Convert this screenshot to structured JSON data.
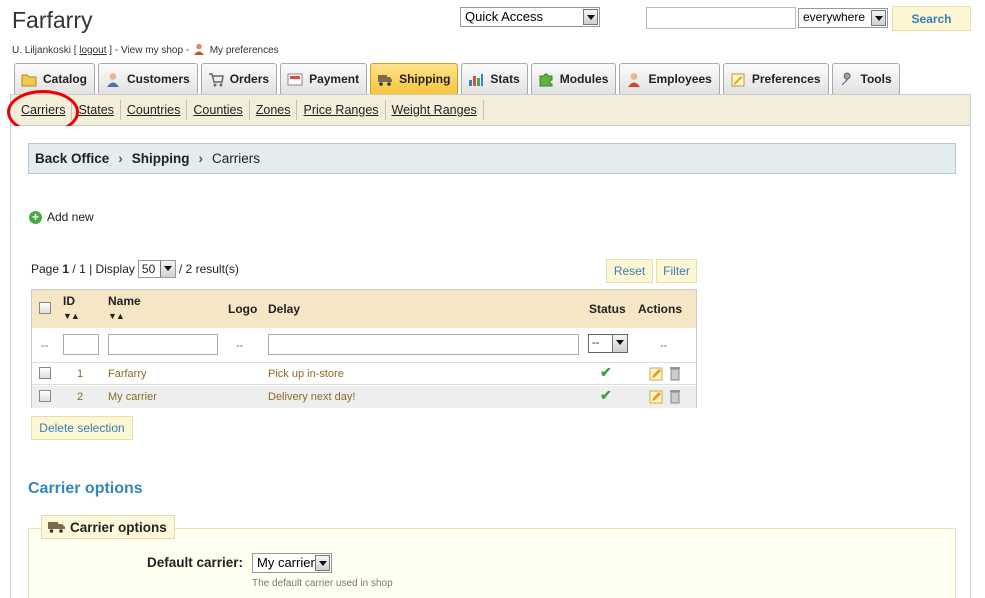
{
  "header": {
    "shop_name": "Farfarry",
    "user_name": "U. Liljankoski",
    "logout_label": "logout",
    "view_shop_label": "View my shop",
    "preferences_label": "My preferences",
    "quick_access_label": "Quick Access",
    "search_value": "",
    "search_scope": "everywhere",
    "search_button_label": "Search"
  },
  "tabs": [
    {
      "label": "Catalog",
      "icon": "folder-icon",
      "active": false
    },
    {
      "label": "Customers",
      "icon": "customer-icon",
      "active": false
    },
    {
      "label": "Orders",
      "icon": "cart-icon",
      "active": false
    },
    {
      "label": "Payment",
      "icon": "payment-icon",
      "active": false
    },
    {
      "label": "Shipping",
      "icon": "truck-icon",
      "active": true
    },
    {
      "label": "Stats",
      "icon": "stats-icon",
      "active": false
    },
    {
      "label": "Modules",
      "icon": "puzzle-icon",
      "active": false
    },
    {
      "label": "Employees",
      "icon": "employee-icon",
      "active": false
    },
    {
      "label": "Preferences",
      "icon": "preferences-icon",
      "active": false
    },
    {
      "label": "Tools",
      "icon": "wrench-icon",
      "active": false
    }
  ],
  "subnav": [
    "Carriers",
    "States",
    "Countries",
    "Counties",
    "Zones",
    "Price Ranges",
    "Weight Ranges"
  ],
  "breadcrumb": {
    "root": "Back Office",
    "section": "Shipping",
    "current": "Carriers"
  },
  "add_new_label": "Add new",
  "pager": {
    "page_label": "Page",
    "page": "1",
    "of": "/ 1 | Display",
    "per_page": "50",
    "results": "/ 2 result(s)"
  },
  "reset_label": "Reset",
  "filter_label": "Filter",
  "table": {
    "columns": {
      "id": "ID",
      "name": "Name",
      "logo": "Logo",
      "delay": "Delay",
      "status": "Status",
      "actions": "Actions"
    },
    "filter_placeholder": "--",
    "status_filter": "--",
    "rows": [
      {
        "id": "1",
        "name": "Farfarry",
        "delay": "Pick up in-store",
        "status": "enabled"
      },
      {
        "id": "2",
        "name": "My carrier",
        "delay": "Delivery next day!",
        "status": "enabled"
      }
    ]
  },
  "delete_selection_label": "Delete selection",
  "carrier_options": {
    "section_title": "Carrier options",
    "legend": "Carrier options",
    "default_carrier_label": "Default carrier:",
    "default_carrier_value": "My carrier",
    "hint": "The default carrier used in shop"
  },
  "colors": {
    "accent": "#3587b8",
    "active_tab": "#f7c53c",
    "highlight_circle": "#ee0000"
  }
}
